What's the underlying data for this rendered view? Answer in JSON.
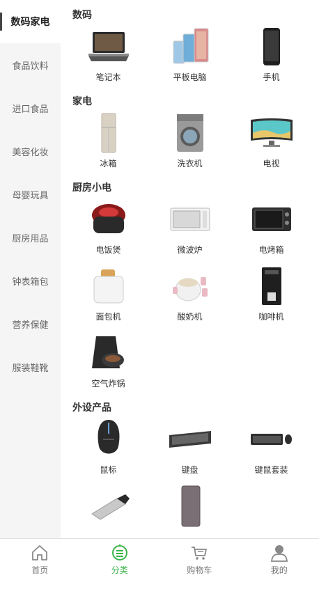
{
  "sidebar": {
    "items": [
      {
        "label": "数码家电"
      },
      {
        "label": "食品饮料"
      },
      {
        "label": "进口食品"
      },
      {
        "label": "美容化妆"
      },
      {
        "label": "母婴玩具"
      },
      {
        "label": "厨房用品"
      },
      {
        "label": "钟表箱包"
      },
      {
        "label": "营养保健"
      },
      {
        "label": "服装鞋靴"
      }
    ]
  },
  "sections": [
    {
      "title": "数码",
      "items": [
        {
          "label": "笔记本",
          "icon": "laptop-icon"
        },
        {
          "label": "平板电脑",
          "icon": "tablet-icon"
        },
        {
          "label": "手机",
          "icon": "phone-icon"
        }
      ]
    },
    {
      "title": "家电",
      "items": [
        {
          "label": "冰箱",
          "icon": "fridge-icon"
        },
        {
          "label": "洗衣机",
          "icon": "washer-icon"
        },
        {
          "label": "电视",
          "icon": "tv-icon"
        }
      ]
    },
    {
      "title": "厨房小电",
      "items": [
        {
          "label": "电饭煲",
          "icon": "rice-cooker-icon"
        },
        {
          "label": "微波炉",
          "icon": "microwave-icon"
        },
        {
          "label": "电烤箱",
          "icon": "oven-icon"
        },
        {
          "label": "面包机",
          "icon": "toaster-icon"
        },
        {
          "label": "酸奶机",
          "icon": "yogurt-maker-icon"
        },
        {
          "label": "咖啡机",
          "icon": "coffee-machine-icon"
        },
        {
          "label": "空气炸锅",
          "icon": "air-fryer-icon"
        }
      ]
    },
    {
      "title": "外设产品",
      "items": [
        {
          "label": "鼠标",
          "icon": "mouse-icon"
        },
        {
          "label": "键盘",
          "icon": "keyboard-icon"
        },
        {
          "label": "键鼠套装",
          "icon": "keyboard-mouse-set-icon"
        },
        {
          "label": "",
          "icon": "usb-drive-icon"
        },
        {
          "label": "",
          "icon": "hard-drive-icon"
        }
      ]
    }
  ],
  "tabbar": {
    "items": [
      {
        "label": "首页",
        "icon": "home-icon"
      },
      {
        "label": "分类",
        "icon": "category-icon"
      },
      {
        "label": "购物车",
        "icon": "cart-icon"
      },
      {
        "label": "我的",
        "icon": "user-icon"
      }
    ],
    "active_color": "#3cb44a"
  }
}
